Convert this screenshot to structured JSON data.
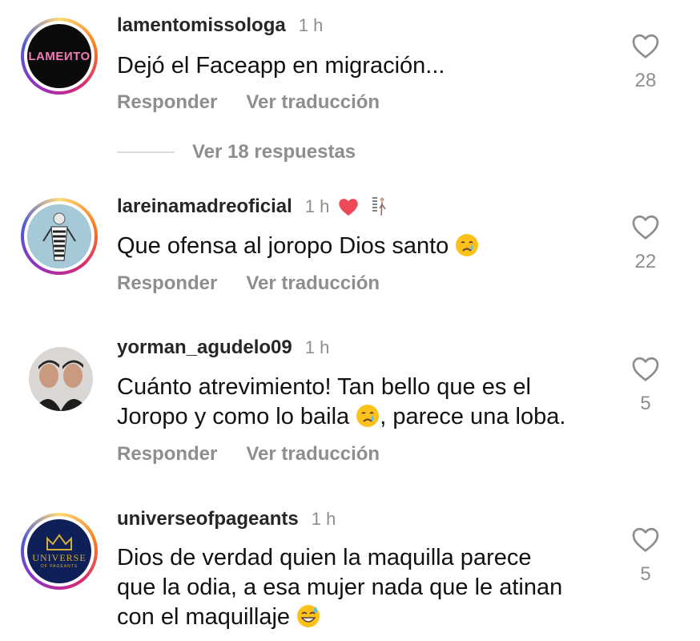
{
  "comments": [
    {
      "username": "lamentomissologa",
      "time": "1 h",
      "avatar_text": "LAMEИTO",
      "text": "Dejó el Faceapp en migración...",
      "reply_label": "Responder",
      "translate_label": "Ver traducción",
      "likes": "28",
      "replies_label": "Ver 18 respuestas"
    },
    {
      "username": "lareinamadreoficial",
      "time": "1 h",
      "text_before_emoji": "Que ofensa al joropo Dios santo",
      "reply_label": "Responder",
      "translate_label": "Ver traducción",
      "likes": "22"
    },
    {
      "username": "yorman_agudelo09",
      "time": "1 h",
      "text_line1": "Cuánto atrevimiento! Tan bello que es el",
      "text_line2_before": "Joropo y como lo baila",
      "text_line2_after": ", parece una loba.",
      "reply_label": "Responder",
      "translate_label": "Ver traducción",
      "likes": "5"
    },
    {
      "username": "universeofpageants",
      "time": "1 h",
      "avatar_text": "UNIVERSE",
      "avatar_subtext": "OF PAGEANTS",
      "text_line1": "Dios de verdad quien la maquilla parece",
      "text_line2": "que la odia, a esa mujer nada que le atinan",
      "text_line3": "con el maquillaje",
      "likes": "5"
    }
  ],
  "colors": {
    "username": "#262626",
    "secondary": "#8e8e8e",
    "heart_red": "#ed4956",
    "story_ring": [
      "#feda75",
      "#fa7e1e",
      "#d62976",
      "#962fbf",
      "#4f5bd5"
    ]
  },
  "icons": [
    "heart-outline-icon",
    "heart-red-icon",
    "crying-face-emoji",
    "sweat-smile-emoji"
  ]
}
